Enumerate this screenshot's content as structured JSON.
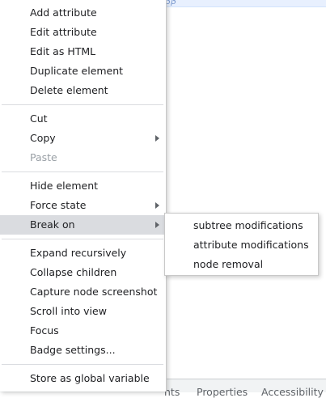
{
  "top_strip": {
    "partial_text": "ββ"
  },
  "menu": {
    "items": [
      {
        "label": "Add attribute"
      },
      {
        "label": "Edit attribute"
      },
      {
        "label": "Edit as HTML"
      },
      {
        "label": "Duplicate element"
      },
      {
        "label": "Delete element"
      },
      {
        "label": "Cut"
      },
      {
        "label": "Copy"
      },
      {
        "label": "Paste"
      },
      {
        "label": "Hide element"
      },
      {
        "label": "Force state"
      },
      {
        "label": "Break on"
      },
      {
        "label": "Expand recursively"
      },
      {
        "label": "Collapse children"
      },
      {
        "label": "Capture node screenshot"
      },
      {
        "label": "Scroll into view"
      },
      {
        "label": "Focus"
      },
      {
        "label": "Badge settings..."
      },
      {
        "label": "Store as global variable"
      }
    ]
  },
  "submenu": {
    "items": [
      {
        "label": "subtree modifications"
      },
      {
        "label": "attribute modifications"
      },
      {
        "label": "node removal"
      }
    ]
  },
  "bottom_tabs": {
    "tab1": "nts",
    "tab2": "Properties",
    "tab3": "Accessibility"
  },
  "colors": {
    "highlight": "#dadce0",
    "disabled_text": "#9aa0a6",
    "separator": "#dadce0"
  },
  "icons": {
    "submenu_arrow": "chevron-right-icon"
  }
}
